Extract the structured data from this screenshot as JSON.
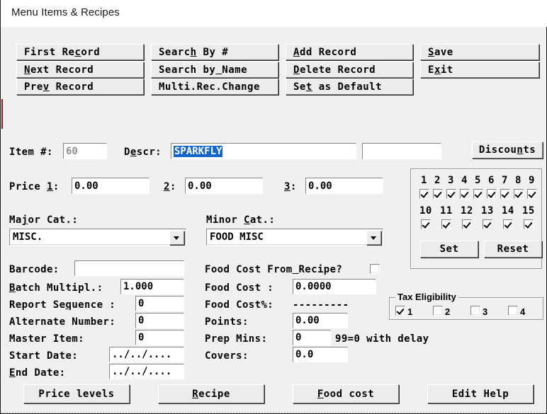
{
  "window": {
    "title": "Menu Items & Recipes"
  },
  "toolbar": {
    "buttons": [
      {
        "name": "first-record",
        "label": "First Record",
        "accel": 8
      },
      {
        "name": "next-record",
        "label": "Next Record",
        "accel": 0
      },
      {
        "name": "prev-record",
        "label": "Prev Record",
        "accel": 3
      },
      {
        "name": "search-by-number",
        "label": "Search By #",
        "accel": 5
      },
      {
        "name": "search-by-name",
        "label": "Search by Name",
        "accel": 9
      },
      {
        "name": "multi-rec-change",
        "label": "Multi.Rec.Change",
        "accel": 14
      },
      {
        "name": "add-record",
        "label": "Add Record",
        "accel": 0
      },
      {
        "name": "delete-record",
        "label": "Delete Record",
        "accel": 0
      },
      {
        "name": "set-as-default",
        "label": "Set as Default",
        "accel": 2
      },
      {
        "name": "save",
        "label": "Save",
        "accel": 0
      },
      {
        "name": "exit",
        "label": "Exit",
        "accel": 1
      }
    ]
  },
  "form": {
    "item_no_label": "Item #:",
    "item_no_value": "60",
    "descr_label": "Descr:",
    "descr_label_accel": 1,
    "descr_value": "SPARKFLY",
    "descr_extra_value": "",
    "discounts_label": "Discounts",
    "discounts_accel": 6,
    "price_label": "Price 1:",
    "price_label_accel": 6,
    "price1": "0.00",
    "price2_label": "2:",
    "price2": "0.00",
    "price3_label": "3:",
    "price3": "0.00",
    "major_cat_label": "Major Cat.:",
    "major_cat_accel": 2,
    "major_cat_value": "MISC.",
    "minor_cat_label": "Minor Cat.:",
    "minor_cat_accel": 6,
    "minor_cat_value": "FOOD MISC",
    "barcode_label": "Barcode:",
    "barcode_value": "",
    "batch_label": "Batch Multipl.:",
    "batch_accel": 0,
    "batch_value": "1.000",
    "report_seq_label": "Report Sequence :",
    "report_seq_accel": 9,
    "report_seq_value": "0",
    "alt_number_label": "Alternate Number:",
    "alt_number_value": "0",
    "master_item_label": "Master Item:",
    "master_item_value": "0",
    "start_date_label": "Start Date:",
    "start_date_value": "../../....",
    "end_date_label": "End Date:",
    "end_date_accel": 0,
    "end_date_value": "../../....",
    "food_cost_recipe_label": "Food Cost From Recipe?",
    "food_cost_recipe_accel": 14,
    "food_cost_recipe_checked": false,
    "food_cost_label": "Food Cost :",
    "food_cost_value": "0.0000",
    "food_cost_pct_label": "Food Cost%:",
    "food_cost_pct_value": "---------",
    "points_label": "Points:",
    "points_value": "0.00",
    "prep_mins_label": "Prep Mins:",
    "prep_mins_value": "0",
    "prep_mins_hint": "99=0 with delay",
    "covers_label": "Covers:",
    "covers_value": "0.0"
  },
  "price_levels_panel": {
    "row1_labels": [
      "1",
      "2",
      "3",
      "4",
      "5",
      "6",
      "7",
      "8",
      "9"
    ],
    "row1_checked": [
      true,
      true,
      true,
      true,
      true,
      true,
      true,
      true,
      true
    ],
    "row2_labels": [
      "10",
      "11",
      "12",
      "13",
      "14",
      "15"
    ],
    "row2_checked": [
      true,
      true,
      true,
      true,
      true,
      true
    ],
    "set_label": "Set",
    "reset_label": "Reset"
  },
  "tax_eligibility": {
    "title": "Tax Eligibility",
    "items": [
      {
        "label": "1",
        "checked": true
      },
      {
        "label": "2",
        "checked": false
      },
      {
        "label": "3",
        "checked": false
      },
      {
        "label": "4",
        "checked": false
      }
    ]
  },
  "bottom_buttons": [
    {
      "name": "price-levels",
      "label": "Price levels",
      "accel": -1
    },
    {
      "name": "recipe",
      "label": "Recipe",
      "accel": 0
    },
    {
      "name": "food-cost",
      "label": "Food cost",
      "accel": 0
    },
    {
      "name": "edit-help",
      "label": "Edit Help",
      "accel": -1
    }
  ],
  "colors": {
    "accent_mark": "#8f1420",
    "selection": "#1266c9",
    "face": "#f0f0f0"
  }
}
